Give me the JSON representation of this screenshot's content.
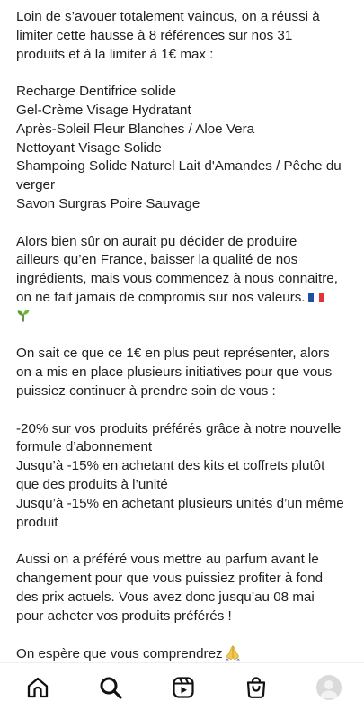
{
  "caption": {
    "paragraphs": [
      {
        "lines": [
          "Loin de s’avouer totalement vaincus, on a réussi à",
          "limiter cette hausse à 8 références sur nos 31",
          "produits et à la limiter à 1€ max :"
        ]
      },
      {
        "lines": [
          "Recharge Dentifrice solide",
          "Gel-Crème Visage Hydratant",
          "Après-Soleil Fleur Blanches / Aloe Vera",
          "Nettoyant Visage Solide",
          "Shampoing Solide Naturel Lait d'Amandes / Pêche du",
          "verger",
          "Savon Surgras Poire Sauvage"
        ]
      },
      {
        "lines": [
          "Alors bien sûr on aurait pu décider de produire",
          "ailleurs qu’en France, baisser la qualité de nos",
          "ingrédients, mais vous commencez à nous connaitre,",
          "on ne fait jamais de compromis sur nos valeurs."
        ],
        "emoji_french_flag": "french-flag-emoji",
        "emoji_sprout": "seedling-emoji"
      },
      {
        "lines": [
          "On sait ce que ce 1€ en plus peut représenter, alors",
          "on a mis en place plusieurs initiatives pour que vous",
          "puissiez continuer à prendre soin de vous :"
        ]
      },
      {
        "lines": [
          "-20% sur vos produits préférés grâce à notre nouvelle",
          "formule d’abonnement",
          "Jusqu’à -15% en achetant des kits et coffrets plutôt",
          "que des produits à l’unité",
          "Jusqu’à -15% en achetant plusieurs unités d’un même",
          "produit"
        ]
      },
      {
        "lines": [
          "Aussi on a préféré vous mettre au parfum avant le",
          "changement pour que vous puissiez profiter à fond",
          "des prix actuels. Vous avez donc jusqu’au 08 mai",
          "pour acheter vos produits préférés !"
        ]
      },
      {
        "lines": [
          "On espère que vous comprendrez"
        ],
        "emoji_hands": "folded-hands-emoji"
      }
    ]
  },
  "bottom_nav": {
    "items": [
      {
        "icon": "home-icon"
      },
      {
        "icon": "search-icon"
      },
      {
        "icon": "reels-icon"
      },
      {
        "icon": "shop-icon"
      },
      {
        "icon": "profile-avatar"
      }
    ]
  },
  "colors": {
    "text": "#1f1f1f",
    "icon": "#111111",
    "background": "#ffffff",
    "divider": "#efefef",
    "avatar_bg": "#dadada",
    "flag_blue": "#1f4fa5",
    "flag_red": "#e0343a",
    "sprout_green": "#5aa02c",
    "hands_yellow": "#f3c74e"
  }
}
